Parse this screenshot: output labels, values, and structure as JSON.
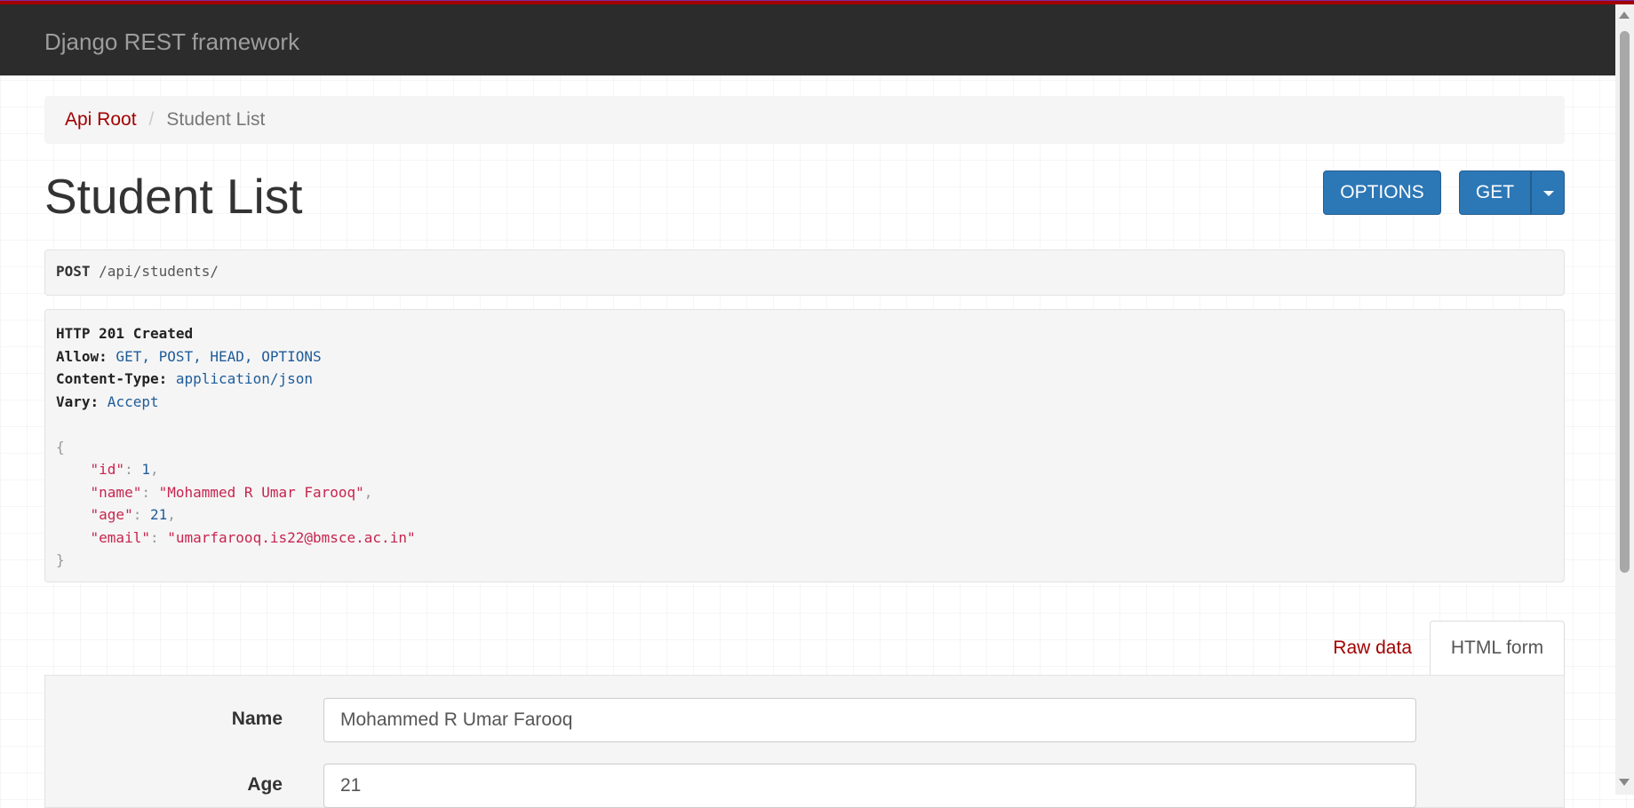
{
  "navbar": {
    "brand": "Django REST framework"
  },
  "breadcrumb": {
    "root": "Api Root",
    "separator": "/",
    "current": "Student List"
  },
  "page": {
    "title": "Student List"
  },
  "buttons": {
    "options": "OPTIONS",
    "get": "GET"
  },
  "request": {
    "method": "POST",
    "path": " /api/students/"
  },
  "response": {
    "status": "HTTP 201 Created",
    "headers": [
      {
        "name": "Allow:",
        "value": " GET, POST, HEAD, OPTIONS"
      },
      {
        "name": "Content-Type:",
        "value": " application/json"
      },
      {
        "name": "Vary:",
        "value": " Accept"
      }
    ],
    "body": {
      "open": "{",
      "close": "}",
      "fields": [
        {
          "key": "\"id\"",
          "value": "1",
          "type": "number",
          "comma": ","
        },
        {
          "key": "\"name\"",
          "value": "\"Mohammed R Umar Farooq\"",
          "type": "string",
          "comma": ","
        },
        {
          "key": "\"age\"",
          "value": "21",
          "type": "number",
          "comma": ","
        },
        {
          "key": "\"email\"",
          "value": "\"umarfarooq.is22@bmsce.ac.in\"",
          "type": "string",
          "comma": ""
        }
      ]
    }
  },
  "tabs": {
    "raw": "Raw data",
    "html": "HTML form"
  },
  "form": {
    "name_label": "Name",
    "name_value": "Mohammed R Umar Farooq",
    "age_label": "Age",
    "age_value": "21"
  },
  "colors": {
    "accent": "#a30000",
    "button": "#2c77b6",
    "navbar": "#2c2c2c"
  }
}
